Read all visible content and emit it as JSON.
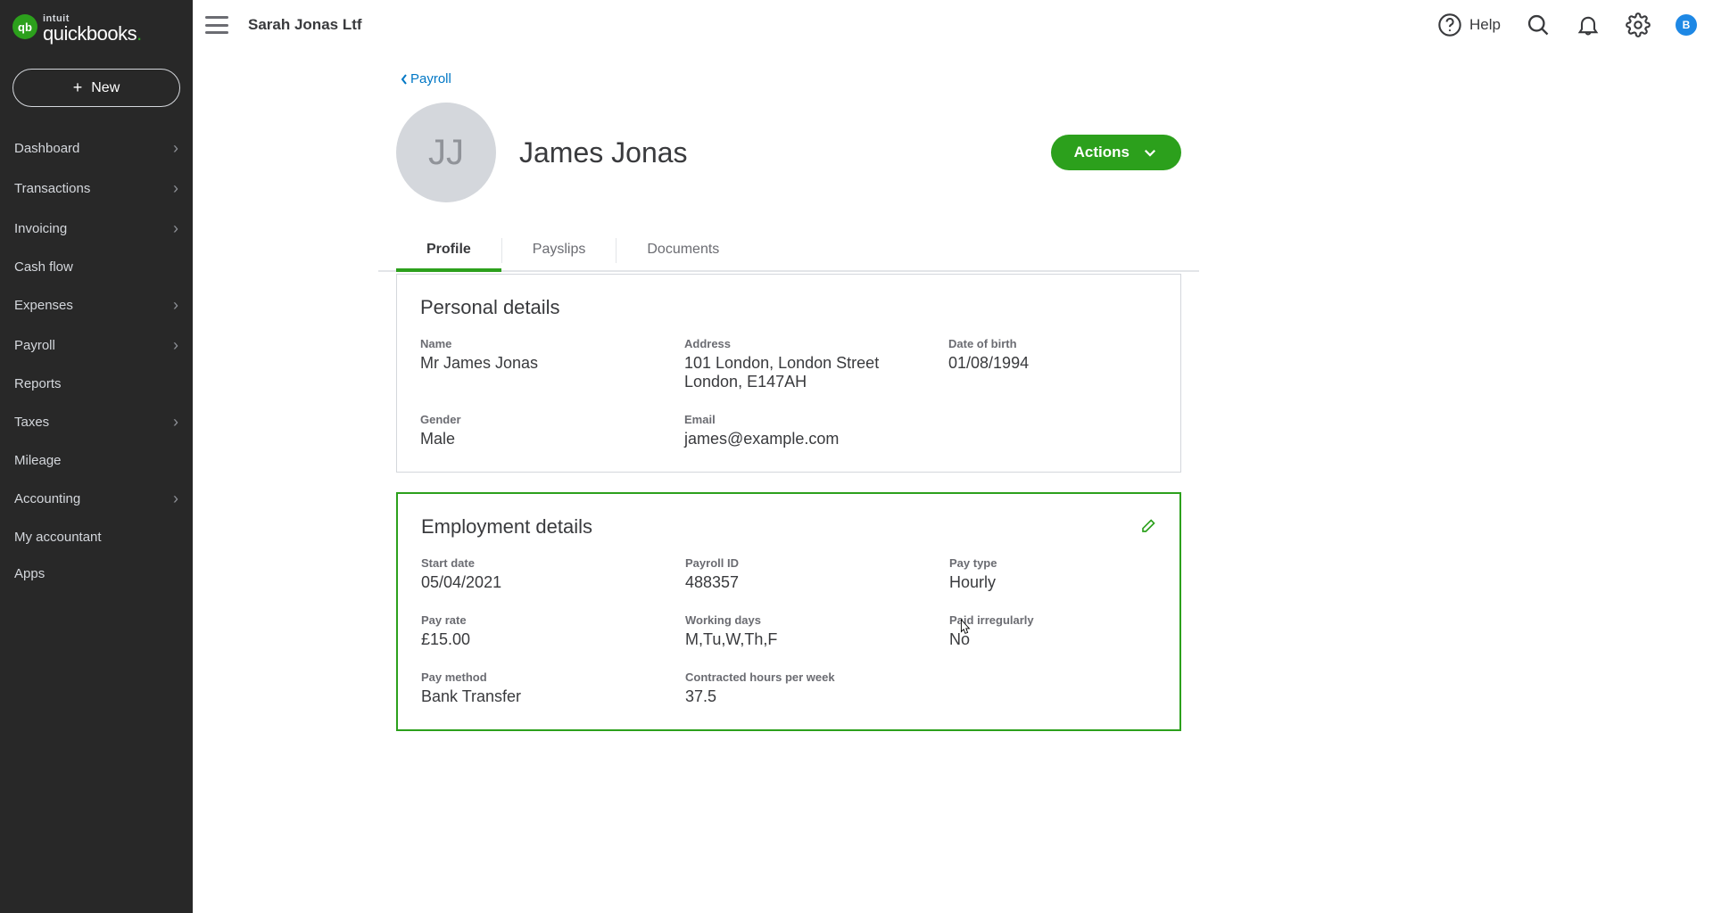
{
  "brand": {
    "badge": "qb",
    "top": "intuit",
    "main": "quickbooks"
  },
  "new_button": "New",
  "nav": [
    {
      "label": "Dashboard",
      "chevron": true
    },
    {
      "label": "Transactions",
      "chevron": true
    },
    {
      "label": "Invoicing",
      "chevron": true
    },
    {
      "label": "Cash flow",
      "chevron": false
    },
    {
      "label": "Expenses",
      "chevron": true
    },
    {
      "label": "Payroll",
      "chevron": true
    },
    {
      "label": "Reports",
      "chevron": false
    },
    {
      "label": "Taxes",
      "chevron": true
    },
    {
      "label": "Mileage",
      "chevron": false
    },
    {
      "label": "Accounting",
      "chevron": true
    },
    {
      "label": "My accountant",
      "chevron": false
    },
    {
      "label": "Apps",
      "chevron": false
    }
  ],
  "topbar": {
    "company": "Sarah Jonas Ltf",
    "help": "Help",
    "avatar_initial": "B"
  },
  "breadcrumb": "Payroll",
  "employee": {
    "initials": "JJ",
    "name": "James Jonas",
    "actions_label": "Actions"
  },
  "tabs": [
    "Profile",
    "Payslips",
    "Documents"
  ],
  "personal": {
    "heading": "Personal details",
    "name_label": "Name",
    "name_value": "Mr James Jonas",
    "address_label": "Address",
    "address_line1": "101 London, London Street",
    "address_line2": "London, E147AH",
    "dob_label": "Date of birth",
    "dob_value": "01/08/1994",
    "gender_label": "Gender",
    "gender_value": "Male",
    "email_label": "Email",
    "email_value": "james@example.com"
  },
  "employment": {
    "heading": "Employment details",
    "start_label": "Start date",
    "start_value": "05/04/2021",
    "payroll_id_label": "Payroll ID",
    "payroll_id_value": "488357",
    "pay_type_label": "Pay type",
    "pay_type_value": "Hourly",
    "pay_rate_label": "Pay rate",
    "pay_rate_value": "£15.00",
    "working_days_label": "Working days",
    "working_days_value": "M,Tu,W,Th,F",
    "paid_irregularly_label": "Paid irregularly",
    "paid_irregularly_value": "No",
    "pay_method_label": "Pay method",
    "pay_method_value": "Bank Transfer",
    "contracted_hours_label": "Contracted hours per week",
    "contracted_hours_value": "37.5"
  }
}
